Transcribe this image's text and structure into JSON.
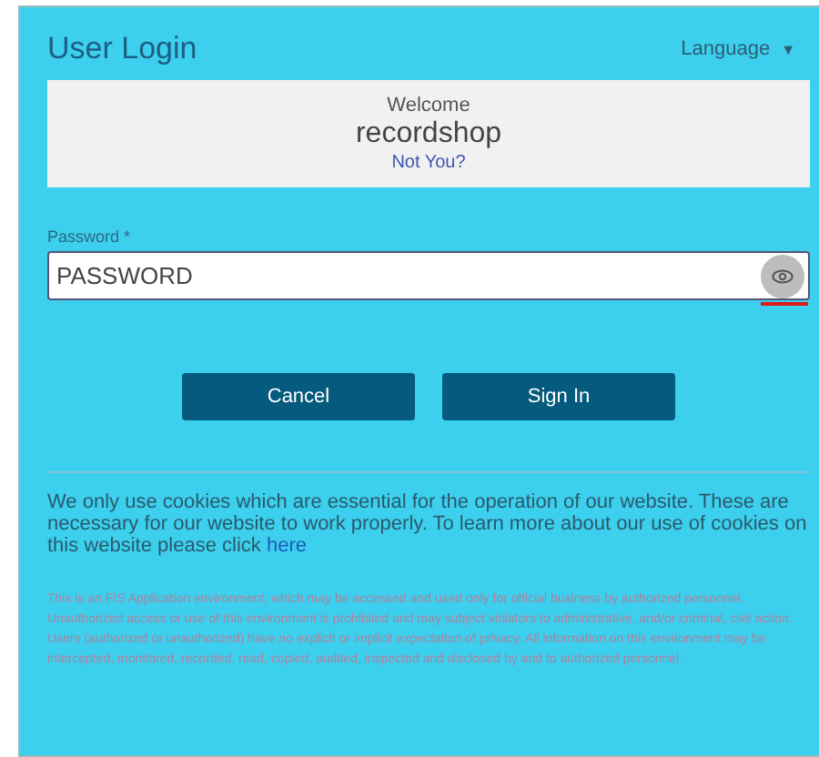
{
  "header": {
    "title": "User Login",
    "language_menu": {
      "label": "Language",
      "glyph": "▼"
    }
  },
  "welcome": {
    "greeting": "Welcome",
    "username": "recordshop",
    "switch_link": "Not You?"
  },
  "password": {
    "label": "Password *",
    "value": "PASSWORD"
  },
  "buttons": [
    {
      "label": "Cancel"
    },
    {
      "label": "Sign In"
    }
  ],
  "cookie_notice": {
    "text": "We only use cookies which are essential for the operation of our website. These are necessary for our website to work properly. To learn more about our use of cookies on this website please click",
    "link": "here"
  },
  "legal_notice": "This is an FIS Application environment, which may be accessed and used only for official business by authorized personnel. Unauthorized access or use of this environment is prohibited and may subject violators to administrative, and/or criminal, civil action. Users (authorized or unauthorized) have no explicit or implicit expectation of privacy. All information on this environment may be intercepted, monitored, recorded, read, copied, audited, inspected and disclosed by and to authorized personnel."
}
